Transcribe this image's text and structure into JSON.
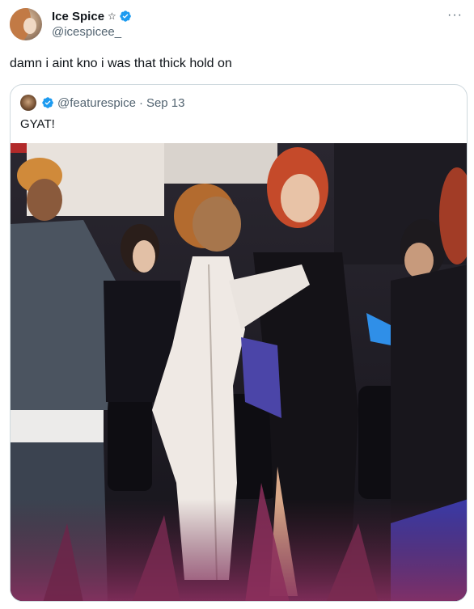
{
  "author": {
    "display_name": "Ice Spice",
    "badge_symbol": "☆",
    "handle": "@icespicee_"
  },
  "more_menu": "···",
  "tweet_text": "damn i aint kno i was that thick hold on",
  "quote": {
    "handle": "@featurespice",
    "separator": "·",
    "date": "Sep 13",
    "text": "GYAT!"
  },
  "icons": {
    "verified": "verified-badge-icon",
    "star": "star-icon",
    "more": "more-options-icon"
  },
  "colors": {
    "verified_blue": "#1d9bf0",
    "text_primary": "#0f1419",
    "text_secondary": "#536471",
    "border": "#cfd9de"
  }
}
